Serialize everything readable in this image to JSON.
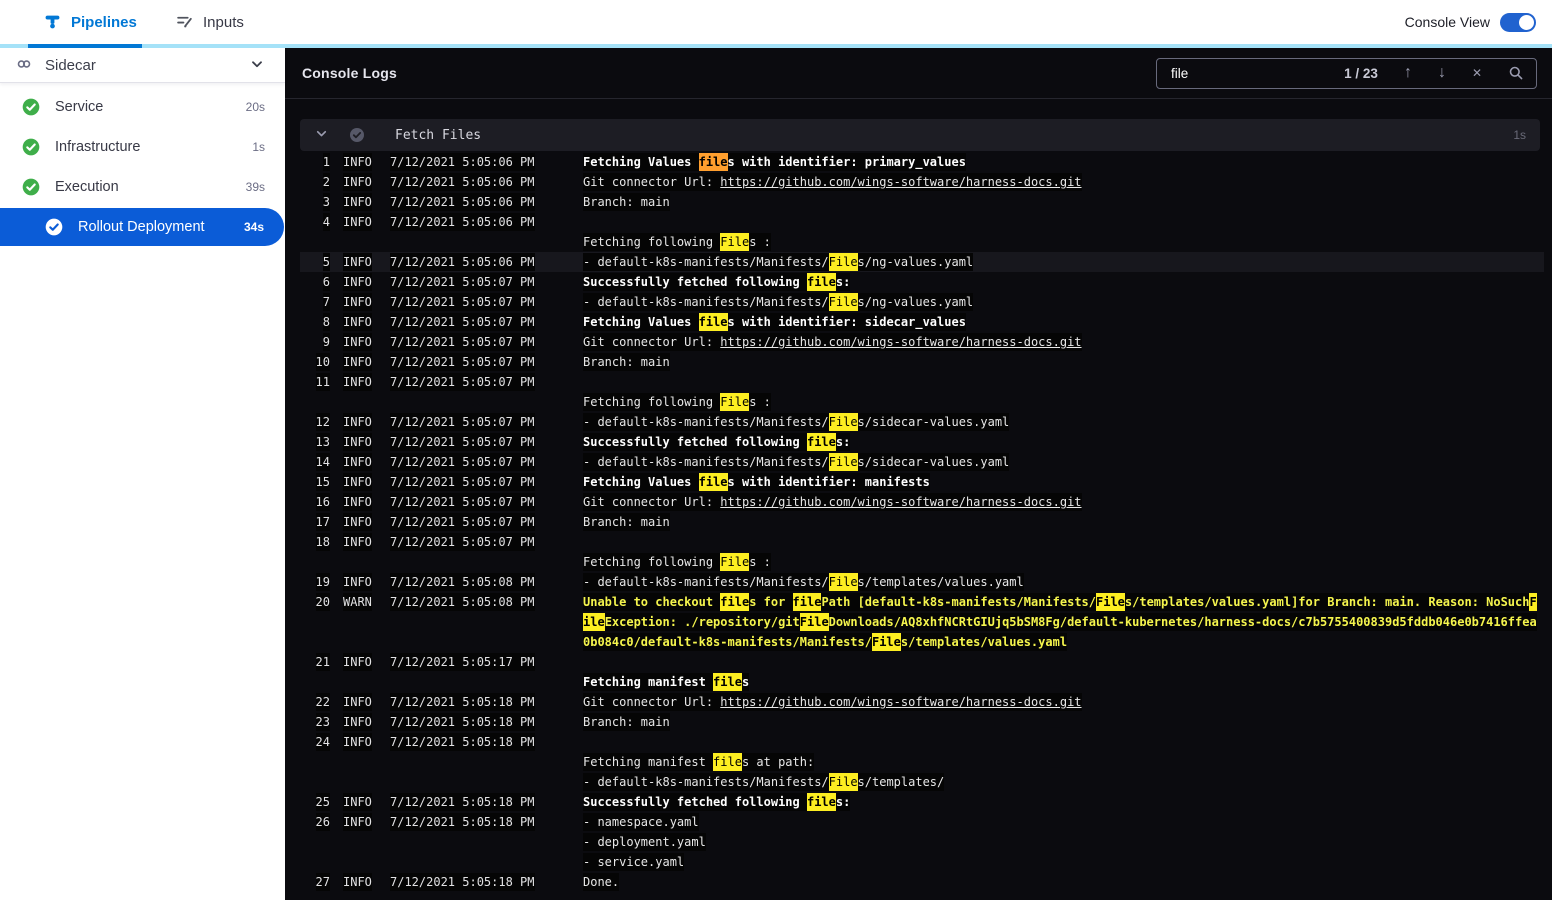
{
  "colors": {
    "accent_blue": "#0278d5",
    "selected_blue": "#0b5cd7",
    "success_green": "#3fae4a",
    "match_yellow": "#fdee21",
    "current_match_orange": "#ff9f2e",
    "warn_text_yellow": "#f5f54d"
  },
  "topbar": {
    "tabs": [
      {
        "label": "Pipelines",
        "active": true
      },
      {
        "label": "Inputs",
        "active": false
      }
    ],
    "console_view_label": "Console View",
    "console_view_on": true
  },
  "sidebar": {
    "group": {
      "label": "Sidecar"
    },
    "steps": [
      {
        "label": "Service",
        "duration": "20s",
        "state": "success",
        "selected": false
      },
      {
        "label": "Infrastructure",
        "duration": "1s",
        "state": "success",
        "selected": false
      },
      {
        "label": "Execution",
        "duration": "39s",
        "state": "success",
        "selected": false
      },
      {
        "label": "Rollout Deployment",
        "duration": "34s",
        "state": "success",
        "selected": true
      }
    ]
  },
  "console": {
    "title": "Console Logs",
    "search": {
      "value": "file",
      "counter": "1 / 23"
    },
    "section": {
      "title": "Fetch Files",
      "duration": "1s"
    },
    "log": {
      "lines": [
        {
          "num": "1",
          "level": "INFO",
          "time": "7/12/2021 5:05:06 PM",
          "bold": true,
          "rows": [
            [
              {
                "t": "Fetching Values "
              },
              {
                "t": "file",
                "h": "c"
              },
              {
                "t": "s with identifier: primary_values"
              }
            ]
          ]
        },
        {
          "num": "2",
          "level": "INFO",
          "time": "7/12/2021 5:05:06 PM",
          "rows": [
            [
              {
                "t": "Git connector Url: "
              },
              {
                "t": "https://github.com/wings-software/harness-docs.git",
                "u": 1
              }
            ]
          ]
        },
        {
          "num": "3",
          "level": "INFO",
          "time": "7/12/2021 5:05:06 PM",
          "rows": [
            [
              {
                "t": "Branch: main"
              }
            ]
          ]
        },
        {
          "num": "4",
          "level": "INFO",
          "time": "7/12/2021 5:05:06 PM",
          "rows": [
            [],
            [
              {
                "t": "Fetching following "
              },
              {
                "t": "File",
                "h": "m"
              },
              {
                "t": "s :"
              }
            ]
          ]
        },
        {
          "num": "5",
          "level": "INFO",
          "time": "7/12/2021 5:05:06 PM",
          "selected": true,
          "rows": [
            [
              {
                "t": "- default-k8s-manifests/Manifests/"
              },
              {
                "t": "File",
                "h": "m"
              },
              {
                "t": "s/ng-values.yaml"
              }
            ]
          ]
        },
        {
          "num": "6",
          "level": "INFO",
          "time": "7/12/2021 5:05:07 PM",
          "bold": true,
          "rows": [
            [
              {
                "t": "Successfully fetched following "
              },
              {
                "t": "file",
                "h": "m"
              },
              {
                "t": "s:"
              }
            ]
          ]
        },
        {
          "num": "7",
          "level": "INFO",
          "time": "7/12/2021 5:05:07 PM",
          "rows": [
            [
              {
                "t": "- default-k8s-manifests/Manifests/"
              },
              {
                "t": "File",
                "h": "m"
              },
              {
                "t": "s/ng-values.yaml"
              }
            ]
          ]
        },
        {
          "num": "8",
          "level": "INFO",
          "time": "7/12/2021 5:05:07 PM",
          "bold": true,
          "rows": [
            [
              {
                "t": "Fetching Values "
              },
              {
                "t": "file",
                "h": "m"
              },
              {
                "t": "s with identifier: sidecar_values"
              }
            ]
          ]
        },
        {
          "num": "9",
          "level": "INFO",
          "time": "7/12/2021 5:05:07 PM",
          "rows": [
            [
              {
                "t": "Git connector Url: "
              },
              {
                "t": "https://github.com/wings-software/harness-docs.git",
                "u": 1
              }
            ]
          ]
        },
        {
          "num": "10",
          "level": "INFO",
          "time": "7/12/2021 5:05:07 PM",
          "rows": [
            [
              {
                "t": "Branch: main"
              }
            ]
          ]
        },
        {
          "num": "11",
          "level": "INFO",
          "time": "7/12/2021 5:05:07 PM",
          "rows": [
            [],
            [
              {
                "t": "Fetching following "
              },
              {
                "t": "File",
                "h": "m"
              },
              {
                "t": "s :"
              }
            ]
          ]
        },
        {
          "num": "12",
          "level": "INFO",
          "time": "7/12/2021 5:05:07 PM",
          "rows": [
            [
              {
                "t": "- default-k8s-manifests/Manifests/"
              },
              {
                "t": "File",
                "h": "m"
              },
              {
                "t": "s/sidecar-values.yaml"
              }
            ]
          ]
        },
        {
          "num": "13",
          "level": "INFO",
          "time": "7/12/2021 5:05:07 PM",
          "bold": true,
          "rows": [
            [
              {
                "t": "Successfully fetched following "
              },
              {
                "t": "file",
                "h": "m"
              },
              {
                "t": "s:"
              }
            ]
          ]
        },
        {
          "num": "14",
          "level": "INFO",
          "time": "7/12/2021 5:05:07 PM",
          "rows": [
            [
              {
                "t": "- default-k8s-manifests/Manifests/"
              },
              {
                "t": "File",
                "h": "m"
              },
              {
                "t": "s/sidecar-values.yaml"
              }
            ]
          ]
        },
        {
          "num": "15",
          "level": "INFO",
          "time": "7/12/2021 5:05:07 PM",
          "bold": true,
          "rows": [
            [
              {
                "t": "Fetching Values "
              },
              {
                "t": "file",
                "h": "m"
              },
              {
                "t": "s with identifier: manifests"
              }
            ]
          ]
        },
        {
          "num": "16",
          "level": "INFO",
          "time": "7/12/2021 5:05:07 PM",
          "rows": [
            [
              {
                "t": "Git connector Url: "
              },
              {
                "t": "https://github.com/wings-software/harness-docs.git",
                "u": 1
              }
            ]
          ]
        },
        {
          "num": "17",
          "level": "INFO",
          "time": "7/12/2021 5:05:07 PM",
          "rows": [
            [
              {
                "t": "Branch: main"
              }
            ]
          ]
        },
        {
          "num": "18",
          "level": "INFO",
          "time": "7/12/2021 5:05:07 PM",
          "rows": [
            [],
            [
              {
                "t": "Fetching following "
              },
              {
                "t": "File",
                "h": "m"
              },
              {
                "t": "s :"
              }
            ]
          ]
        },
        {
          "num": "19",
          "level": "INFO",
          "time": "7/12/2021 5:05:08 PM",
          "rows": [
            [
              {
                "t": "- default-k8s-manifests/Manifests/"
              },
              {
                "t": "File",
                "h": "m"
              },
              {
                "t": "s/templates/values.yaml"
              }
            ]
          ]
        },
        {
          "num": "20",
          "level": "WARN",
          "time": "7/12/2021 5:05:08 PM",
          "bold": true,
          "warn": true,
          "rows": [
            [
              {
                "t": "Unable to checkout "
              },
              {
                "t": "file",
                "h": "m"
              },
              {
                "t": "s for "
              },
              {
                "t": "file",
                "h": "m"
              },
              {
                "t": "Path [default-k8s-manifests/Manifests/"
              },
              {
                "t": "File",
                "h": "m"
              },
              {
                "t": "s/templates/values.yaml]for Branch: main. Reason: NoSuch"
              },
              {
                "t": "F",
                "h": "m"
              }
            ],
            [
              {
                "t": "ile",
                "h": "m"
              },
              {
                "t": "Exception: ./repository/git"
              },
              {
                "t": "File",
                "h": "m"
              },
              {
                "t": "Downloads/AQ8xhfNCRtGIUjq5bSM8Fg/default-kubernetes/harness-docs/c7b5755400839d5fddb046e0b7416ffea"
              }
            ],
            [
              {
                "t": "0b084c0/default-k8s-manifests/Manifests/"
              },
              {
                "t": "File",
                "h": "m"
              },
              {
                "t": "s/templates/values.yaml"
              }
            ]
          ]
        },
        {
          "num": "21",
          "level": "INFO",
          "time": "7/12/2021 5:05:17 PM",
          "bold": true,
          "rows": [
            [],
            [
              {
                "t": "Fetching manifest "
              },
              {
                "t": "file",
                "h": "m"
              },
              {
                "t": "s"
              }
            ]
          ]
        },
        {
          "num": "22",
          "level": "INFO",
          "time": "7/12/2021 5:05:18 PM",
          "rows": [
            [
              {
                "t": "Git connector Url: "
              },
              {
                "t": "https://github.com/wings-software/harness-docs.git",
                "u": 1
              }
            ]
          ]
        },
        {
          "num": "23",
          "level": "INFO",
          "time": "7/12/2021 5:05:18 PM",
          "rows": [
            [
              {
                "t": "Branch: main"
              }
            ]
          ]
        },
        {
          "num": "24",
          "level": "INFO",
          "time": "7/12/2021 5:05:18 PM",
          "rows": [
            [],
            [
              {
                "t": "Fetching manifest "
              },
              {
                "t": "file",
                "h": "m"
              },
              {
                "t": "s at path:"
              }
            ],
            [
              {
                "t": "- default-k8s-manifests/Manifests/"
              },
              {
                "t": "File",
                "h": "m"
              },
              {
                "t": "s/templates/"
              }
            ]
          ]
        },
        {
          "num": "25",
          "level": "INFO",
          "time": "7/12/2021 5:05:18 PM",
          "bold": true,
          "rows": [
            [
              {
                "t": "Successfully fetched following "
              },
              {
                "t": "file",
                "h": "m"
              },
              {
                "t": "s:"
              }
            ]
          ]
        },
        {
          "num": "26",
          "level": "INFO",
          "time": "7/12/2021 5:05:18 PM",
          "rows": [
            [
              {
                "t": "- namespace.yaml"
              }
            ],
            [
              {
                "t": "- deployment.yaml"
              }
            ],
            [
              {
                "t": "- service.yaml"
              }
            ]
          ]
        },
        {
          "num": "27",
          "level": "INFO",
          "time": "7/12/2021 5:05:18 PM",
          "rows": [
            [
              {
                "t": "Done."
              }
            ]
          ]
        }
      ]
    }
  }
}
